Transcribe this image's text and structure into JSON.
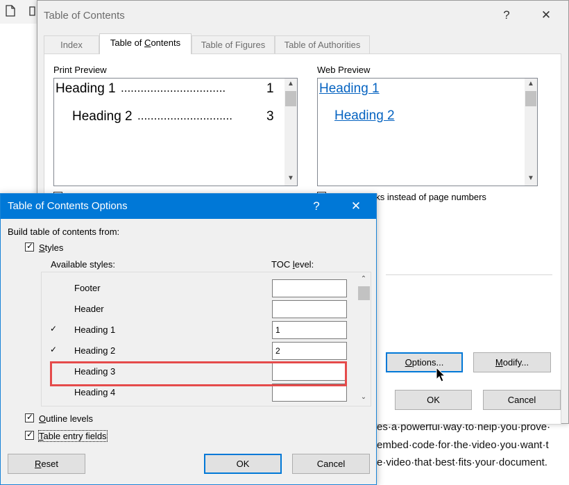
{
  "toc_dialog": {
    "title": "Table of Contents",
    "help_glyph": "?",
    "close_glyph": "✕",
    "tabs": [
      {
        "label": "Index",
        "active": false
      },
      {
        "label": "Table of Contents",
        "active": true
      },
      {
        "label": "Table of Figures",
        "active": false
      },
      {
        "label": "Table of Authorities",
        "active": false
      }
    ],
    "print_preview": {
      "label": "Print Preview",
      "heading1": "Heading 1",
      "heading1_dots": "................................",
      "heading1_page": "1",
      "heading2": "Heading 2",
      "heading2_dots": ".............................",
      "heading2_page": "3"
    },
    "web_preview": {
      "label": "Web Preview",
      "heading1": "Heading 1",
      "heading2": "Heading 2"
    },
    "hyperlinks_option": "nks instead of page numbers",
    "options_button": "Options...",
    "modify_button": "Modify...",
    "ok_button": "OK",
    "cancel_button": "Cancel"
  },
  "options_dialog": {
    "title": "Table of Contents Options",
    "help_glyph": "?",
    "close_glyph": "✕",
    "build_from_label": "Build table of contents from:",
    "styles_checkbox": {
      "label": "Styles",
      "checked": true
    },
    "available_styles_header": "Available styles:",
    "toc_level_header": "TOC level:",
    "styles": [
      {
        "name": "Footer",
        "checked": false,
        "level": ""
      },
      {
        "name": "Header",
        "checked": false,
        "level": ""
      },
      {
        "name": "Heading 1",
        "checked": true,
        "level": "1"
      },
      {
        "name": "Heading 2",
        "checked": true,
        "level": "2"
      },
      {
        "name": "Heading 3",
        "checked": false,
        "level": ""
      },
      {
        "name": "Heading 4",
        "checked": false,
        "level": ""
      }
    ],
    "outline_levels": {
      "label": "Outline levels",
      "checked": true
    },
    "table_entry_fields": {
      "label": "Table entry fields",
      "checked": true
    },
    "reset_button": "Reset",
    "ok_button": "OK",
    "cancel_button": "Cancel"
  },
  "document": {
    "lines": [
      "es·a·powerful·way·to·help·you·prove·",
      "embed·code·for·the·video·you·want·t",
      "e·video·that·best·fits·your·document."
    ]
  },
  "colors": {
    "accent_blue": "#0078d7",
    "link_blue": "#0563c1",
    "highlight_red": "#e54b4b"
  }
}
